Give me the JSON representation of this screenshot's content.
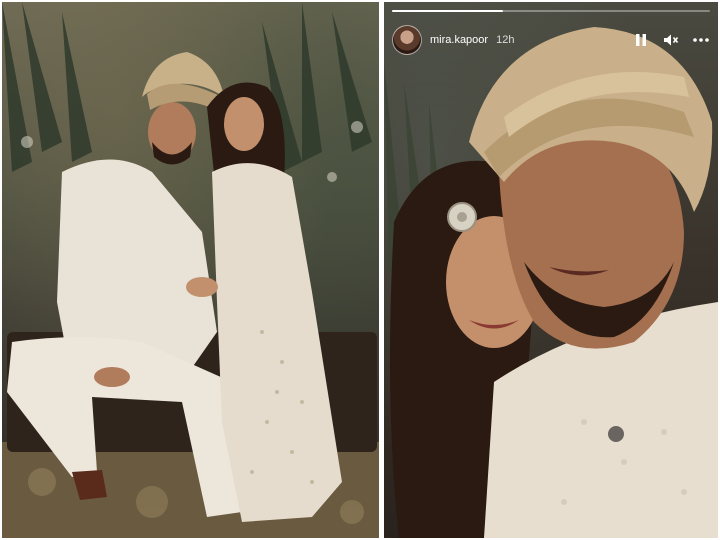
{
  "story": {
    "username": "mira.kapoor",
    "time_ago": "12h",
    "progress": 0.35,
    "controls": {
      "pause_icon": "pause-icon",
      "mute_icon": "speaker-muted-icon",
      "more_icon": "more-options-icon"
    }
  },
  "colors": {
    "background": "#ffffff",
    "header_text": "#ffffff"
  }
}
